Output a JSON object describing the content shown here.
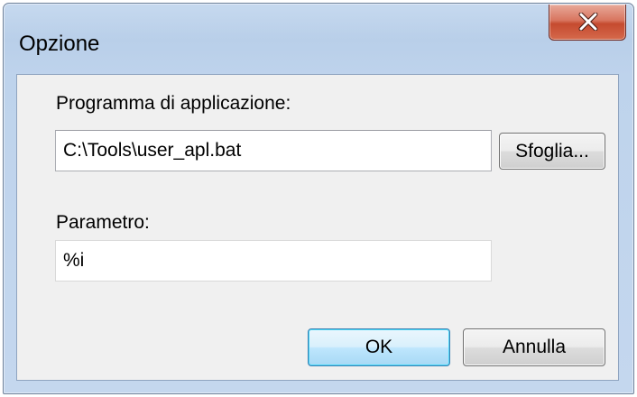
{
  "window": {
    "title": "Opzione"
  },
  "form": {
    "program_label": "Programma di applicazione:",
    "program_value": "C:\\Tools\\user_apl.bat",
    "browse_label": "Sfoglia...",
    "parameter_label": "Parametro:",
    "parameter_value": "%i"
  },
  "buttons": {
    "ok_label": "OK",
    "cancel_label": "Annulla"
  },
  "colors": {
    "titlebar": "#b9cfe9",
    "close_button": "#c54a2f",
    "default_button_border": "#3c7fb1",
    "dialog_background": "#f0f0f0"
  },
  "icons": {
    "close": "close-icon"
  }
}
